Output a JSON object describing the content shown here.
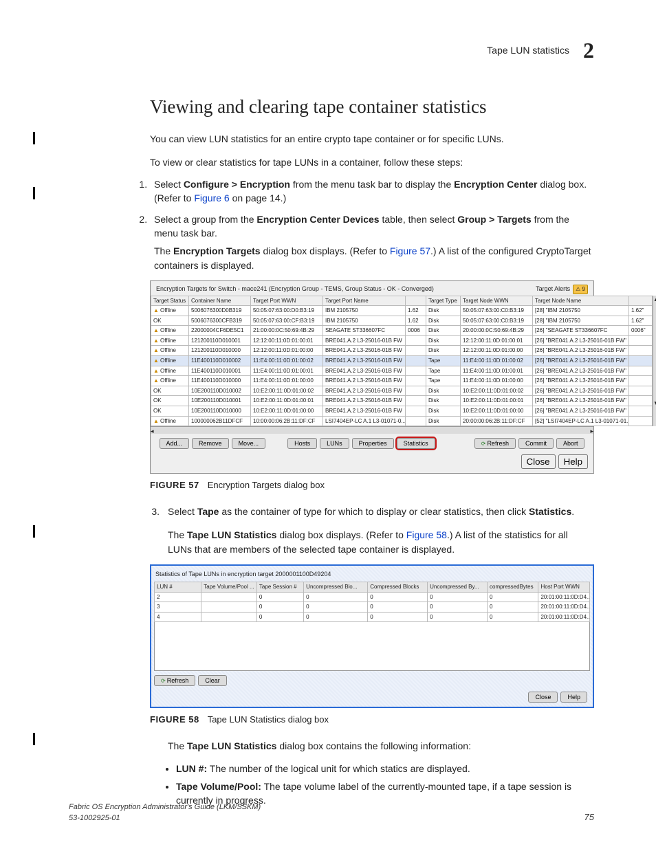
{
  "header": {
    "running_title": "Tape LUN statistics",
    "chapter_number": "2"
  },
  "h1": "Viewing and clearing tape container statistics",
  "intro1": "You can view LUN statistics for an entire crypto tape container or for specific LUNs.",
  "intro2": "To view or clear statistics for tape LUNs in a container, follow these steps:",
  "step1a": "Select ",
  "step1b": "Configure > Encryption",
  "step1c": " from the menu task bar to display the ",
  "step1d": "Encryption Center",
  "step1e": " dialog box. (Refer to ",
  "step1link": "Figure 6",
  "step1f": " on page 14.)",
  "step2a": "Select a group from the ",
  "step2b": "Encryption Center Devices",
  "step2c": " table, then select ",
  "step2d": "Group > Targets",
  "step2e": " from the menu task bar.",
  "step2body_a": "The ",
  "step2body_b": "Encryption Targets",
  "step2body_c": " dialog box displays. (Refer to ",
  "step2body_link": "Figure 57",
  "step2body_d": ".) A list of the configured CryptoTarget containers is displayed.",
  "fig57": {
    "title": "Encryption Targets for Switch - mace241 (Encryption Group - TEMS, Group Status - OK - Converged)",
    "alerts_label": "Target Alerts",
    "alerts_count": "9",
    "cols": [
      "Target Status",
      "Container Name",
      "Target Port WWN",
      "Target Port Name",
      "",
      "Target Type",
      "Target Node WWN",
      "Target Node Name",
      ""
    ],
    "rows": [
      {
        "status": "Offline",
        "c": "5006076300D0B319",
        "p": "50:05:07:63:00:D0:B3:19",
        "n": "IBM    2105750",
        "r": "1.62",
        "t": "Disk",
        "nw": "50:05:07:63:00:C0:B3:19",
        "nn": "[28] \"IBM    2105750",
        "e": "1.62\""
      },
      {
        "status": "OK",
        "c": "5006076300CFB319",
        "p": "50:05:07:63:00:CF:B3:19",
        "n": "IBM    2105750",
        "r": "1.62",
        "t": "Disk",
        "nw": "50:05:07:63:00:C0:B3:19",
        "nn": "[28] \"IBM    2105750",
        "e": "1.62\""
      },
      {
        "status": "Offline",
        "c": "22000004CF6DE5C1",
        "p": "21:00:00:0C:50:69:4B:29",
        "n": "SEAGATE ST336607FC",
        "r": "0006",
        "t": "Disk",
        "nw": "20:00:00:0C:50:69:4B:29",
        "nn": "[26] \"SEAGATE ST336607FC",
        "e": "0006\""
      },
      {
        "status": "Offline",
        "c": "121200110D010001",
        "p": "12:12:00:11:0D:01:00:01",
        "n": "BRE041.A.2 L3-25016-01B FW",
        "r": "",
        "t": "Disk",
        "nw": "12:12:00:11:0D:01:00:01",
        "nn": "[26] \"BRE041.A.2 L3-25016-01B FW\"",
        "e": ""
      },
      {
        "status": "Offline",
        "c": "121200110D010000",
        "p": "12:12:00:11:0D:01:00:00",
        "n": "BRE041.A.2 L3-25016-01B FW",
        "r": "",
        "t": "Disk",
        "nw": "12:12:00:11:0D:01:00:00",
        "nn": "[26] \"BRE041.A.2 L3-25016-01B FW\"",
        "e": ""
      },
      {
        "status": "Offline",
        "c": "11E400110D010002",
        "p": "11:E4:00:11:0D:01:00:02",
        "n": "BRE041.A.2 L3-25016-01B FW",
        "r": "",
        "t": "Tape",
        "nw": "11:E4:00:11:0D:01:00:02",
        "nn": "[26] \"BRE041.A.2 L3-25016-01B FW\"",
        "e": "",
        "sel": true
      },
      {
        "status": "Offline",
        "c": "11E400110D010001",
        "p": "11:E4:00:11:0D:01:00:01",
        "n": "BRE041.A.2 L3-25016-01B FW",
        "r": "",
        "t": "Tape",
        "nw": "11:E4:00:11:0D:01:00:01",
        "nn": "[26] \"BRE041.A.2 L3-25016-01B FW\"",
        "e": ""
      },
      {
        "status": "Offline",
        "c": "11E400110D010000",
        "p": "11:E4:00:11:0D:01:00:00",
        "n": "BRE041.A.2 L3-25016-01B FW",
        "r": "",
        "t": "Tape",
        "nw": "11:E4:00:11:0D:01:00:00",
        "nn": "[26] \"BRE041.A.2 L3-25016-01B FW\"",
        "e": ""
      },
      {
        "status": "OK",
        "c": "10E200110D010002",
        "p": "10:E2:00:11:0D:01:00:02",
        "n": "BRE041.A.2 L3-25016-01B FW",
        "r": "",
        "t": "Disk",
        "nw": "10:E2:00:11:0D:01:00:02",
        "nn": "[26] \"BRE041.A.2 L3-25016-01B FW\"",
        "e": ""
      },
      {
        "status": "OK",
        "c": "10E200110D010001",
        "p": "10:E2:00:11:0D:01:00:01",
        "n": "BRE041.A.2 L3-25016-01B FW",
        "r": "",
        "t": "Disk",
        "nw": "10:E2:00:11:0D:01:00:01",
        "nn": "[26] \"BRE041.A.2 L3-25016-01B FW\"",
        "e": ""
      },
      {
        "status": "OK",
        "c": "10E200110D010000",
        "p": "10:E2:00:11:0D:01:00:00",
        "n": "BRE041.A.2 L3-25016-01B FW",
        "r": "",
        "t": "Disk",
        "nw": "10:E2:00:11:0D:01:00:00",
        "nn": "[26] \"BRE041.A.2 L3-25016-01B FW\"",
        "e": ""
      },
      {
        "status": "Offline",
        "c": "100000062B11DFCF",
        "p": "10:00:00:06:2B:11:DF:CF",
        "n": "LSI7404EP-LC A.1 L3-01071-0...",
        "r": "",
        "t": "Disk",
        "nw": "20:00:00:06:2B:11:DF:CF",
        "nn": "[52] \"LSI7404EP-LC A.1 L3-01071-01...",
        "e": ""
      }
    ],
    "btns": {
      "add": "Add...",
      "remove": "Remove",
      "move": "Move...",
      "hosts": "Hosts",
      "luns": "LUNs",
      "props": "Properties",
      "stats": "Statistics",
      "refresh": "Refresh",
      "commit": "Commit",
      "abort": "Abort",
      "close": "Close",
      "help": "Help"
    },
    "caption_label": "FIGURE 57",
    "caption_text": "Encryption Targets dialog box"
  },
  "step3a": "Select ",
  "step3b": "Tape",
  "step3c": " as the container of type for which to display or clear statistics, then click ",
  "step3d": "Statistics",
  "step3e": ".",
  "step3body_a": "The ",
  "step3body_b": "Tape LUN Statistics",
  "step3body_c": " dialog box displays. (Refer to ",
  "step3body_link": "Figure 58",
  "step3body_d": ".) A list of the statistics for all LUNs that are members of the selected tape container is displayed.",
  "fig58": {
    "title": "Statistics of Tape LUNs in encryption target  2000001100D49204",
    "cols": [
      "LUN #",
      "Tape Volume/Pool ...",
      "Tape Session #",
      "Uncompressed Blo...",
      "Compressed Blocks",
      "Uncompressed By...",
      "compressedBytes",
      "Host Port WWN"
    ],
    "rows": [
      {
        "lun": "2",
        "vol": "",
        "sess": "0",
        "ub": "0",
        "cb": "0",
        "uby": "0",
        "cby": "0",
        "h": "20:01:00:11:0D:D4..."
      },
      {
        "lun": "3",
        "vol": "",
        "sess": "0",
        "ub": "0",
        "cb": "0",
        "uby": "0",
        "cby": "0",
        "h": "20:01:00:11:0D:D4..."
      },
      {
        "lun": "4",
        "vol": "",
        "sess": "0",
        "ub": "0",
        "cb": "0",
        "uby": "0",
        "cby": "0",
        "h": "20:01:00:11:0D:D4..."
      }
    ],
    "btns": {
      "refresh": "Refresh",
      "clear": "Clear",
      "close": "Close",
      "help": "Help"
    },
    "caption_label": "FIGURE 58",
    "caption_text": "Tape LUN Statistics dialog box"
  },
  "post_fig58_a": "The ",
  "post_fig58_b": "Tape LUN Statistics",
  "post_fig58_c": " dialog box contains the following information:",
  "bullet1_b": "LUN #:",
  "bullet1": " The number of the logical unit for which statics are displayed.",
  "bullet2_b": "Tape Volume/Pool:",
  "bullet2": " The tape volume label of the currently-mounted tape, if a tape session is currently in progress.",
  "footer": {
    "left1": "Fabric OS Encryption Administrator's Guide  (LKM/SSKM)",
    "left2": "53-1002925-01",
    "page": "75"
  }
}
